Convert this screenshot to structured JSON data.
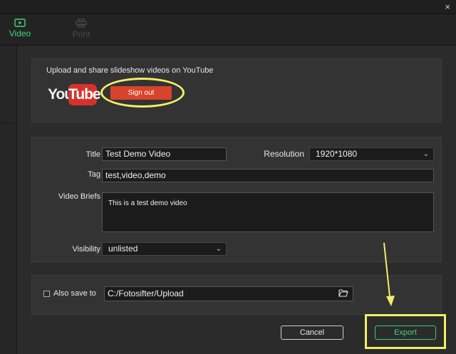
{
  "window": {
    "close_glyph": "×"
  },
  "tabs": [
    {
      "label": "Video",
      "icon": "video-icon",
      "active": true
    },
    {
      "label": "Print",
      "icon": "printer-icon",
      "active": false
    }
  ],
  "youtube": {
    "heading": "Upload and share slideshow videos on YouTube",
    "logo_you": "You",
    "logo_tube": "Tube",
    "sign_out_label": "Sign out"
  },
  "form": {
    "title_label": "Title",
    "title_value": "Test Demo Video",
    "resolution_label": "Resolution",
    "resolution_value": "1920*1080",
    "tag_label": "Tag",
    "tag_value": "test,video,demo",
    "briefs_label": "Video Briefs",
    "briefs_value": "This is a test demo video",
    "visibility_label": "Visibility",
    "visibility_value": "unlisted"
  },
  "save": {
    "also_save_label": "Also save to",
    "path_value": "C:/Fotosifter/Upload",
    "checked": false
  },
  "actions": {
    "cancel_label": "Cancel",
    "export_label": "Export"
  },
  "colors": {
    "accent_green": "#43d47a",
    "signout_red": "#d8432b",
    "highlight_yellow": "#f1ee66"
  }
}
